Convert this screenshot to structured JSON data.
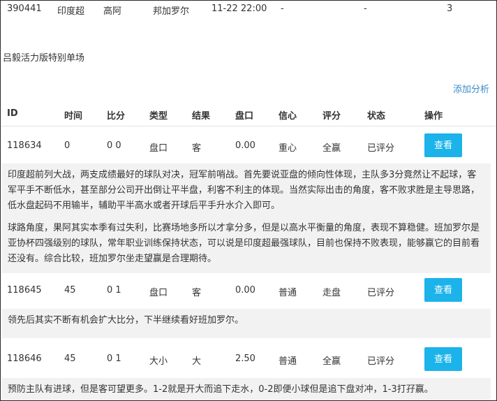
{
  "match": {
    "id": "390441",
    "league": "印度超",
    "home": "高阿",
    "away": "邦加罗尔",
    "time": "11-22 22:00",
    "col6": "-",
    "col7": "-",
    "col8": "3"
  },
  "expert_title": "吕毅活力版特别单场",
  "add_analysis_label": "添加分析",
  "table": {
    "headers": [
      "ID",
      "时间",
      "比分",
      "类型",
      "结果",
      "盘口",
      "信心",
      "评分",
      "状态",
      "操作"
    ],
    "rows": [
      {
        "id": "118634",
        "time": "0",
        "score": "0 0",
        "type": "盘口",
        "result": "客",
        "line": "0.00",
        "confidence": "重心",
        "rating": "全赢",
        "status": "已评分",
        "action": "查看",
        "analysis": [
          "印度超前列大战，两支成绩最好的球队对决，冠军前哨战。首先要说亚盘的倾向性体现，主队多3分竟然让不起球，客军平手不断低水，甚至部分公司开出倒让平半盘，利客不利主的体现。当然实际出击的角度，客不败求胜是主导思路，低水盘起码不用输半，辅助平半高水或者开球后平手升水介入即可。",
          "球路角度，果阿其实本季有过失利，比赛场地多所以才拿分多，但是以高水平衡量的角度，表现不算稳健。班加罗尔是亚协杯四强级别的球队，常年职业训练保持状态，可以说是印度超最强球队，目前也保持不败表现，能够赢它的目前看还没有。综合比较，班加罗尔坐走望赢是合理期待。"
        ]
      },
      {
        "id": "118645",
        "time": "45",
        "score": "0 1",
        "type": "盘口",
        "result": "客",
        "line": "0.00",
        "confidence": "普通",
        "rating": "走盘",
        "status": "已评分",
        "action": "查看",
        "analysis": [
          "领先后其实不断有机会扩大比分，下半继续看好班加罗尔。"
        ]
      },
      {
        "id": "118646",
        "time": "45",
        "score": "0 1",
        "type": "大小",
        "result": "大",
        "line": "2.50",
        "confidence": "普通",
        "rating": "全赢",
        "status": "已评分",
        "action": "查看",
        "analysis": [
          "预防主队有进球，但是客可望更多。1-2就是开大而追下走水，0-2即便小球但是追下盘对冲，1-3打孖赢。"
        ]
      }
    ]
  }
}
